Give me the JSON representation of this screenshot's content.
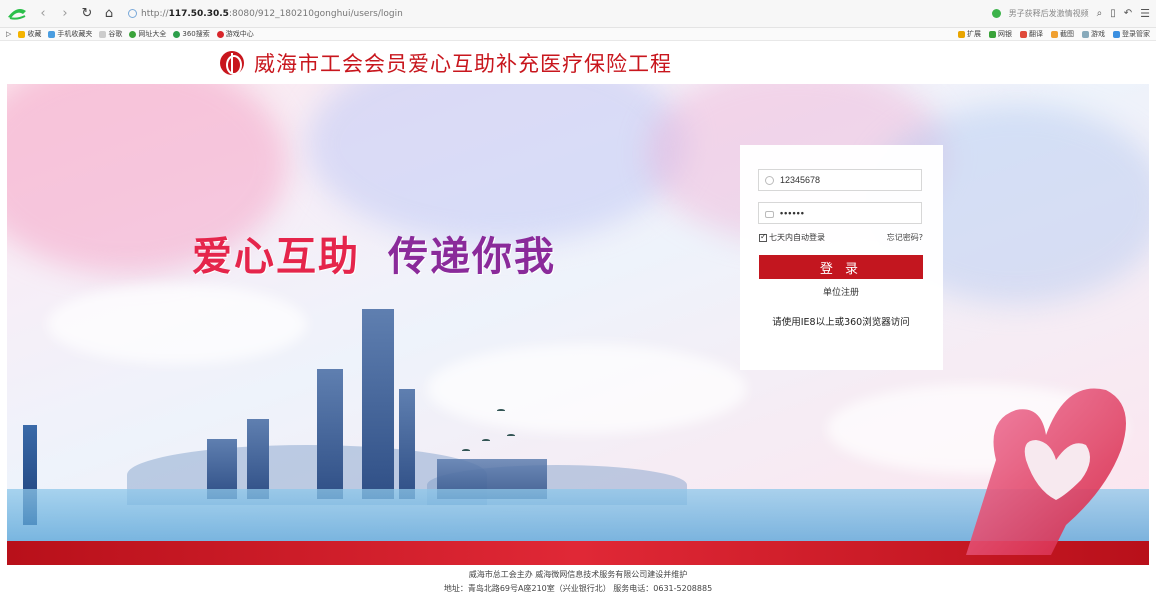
{
  "browser": {
    "url_prefix": "http://",
    "url_host": "117.50.30.5",
    "url_path": ":8080/912_180210gonghui/users/login",
    "news_ticker": "男子获释后发激情视频",
    "bookmarks": [
      "收藏",
      "手机收藏夹",
      "谷歌",
      "网址大全",
      "360搜索",
      "游戏中心"
    ],
    "extensions": [
      "扩展",
      "网银",
      "翻译",
      "截图",
      "游戏",
      "登录管家"
    ]
  },
  "header": {
    "title": "威海市工会会员爱心互助补充医疗保险工程"
  },
  "banner": {
    "slogan_part1": "爱心互助",
    "slogan_part2": "传递你我"
  },
  "login": {
    "username_value": "12345678",
    "password_value": "••••••",
    "remember_label": "七天内自动登录",
    "remember_checked": true,
    "forgot_label": "忘记密码?",
    "submit_label": "登 录",
    "register_label": "单位注册",
    "browser_tip": "请使用IE8以上或360浏览器访问"
  },
  "footer": {
    "line1": "威海市总工会主办 威海微网信息技术服务有限公司建设并维护",
    "line2": "地址：青岛北路69号A座210室（兴业银行北） 服务电话：0631-5208885"
  },
  "colors": {
    "brand_red": "#c8161d",
    "button_red": "#c3161f",
    "slogan_pink": "#e5254b",
    "slogan_purple": "#8a2a9a"
  }
}
